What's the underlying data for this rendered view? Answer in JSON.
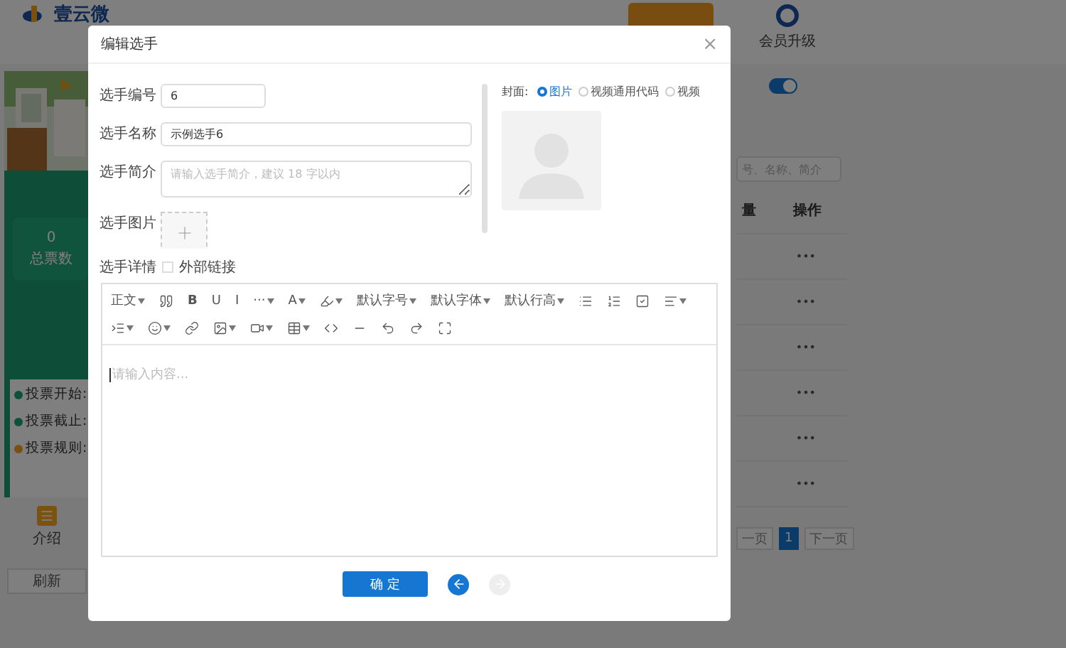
{
  "header": {
    "logo": "壹云微",
    "upgrade": "会员升级"
  },
  "preview": {
    "total_value": "0",
    "total_label": "总票数",
    "info": [
      {
        "label": "投票开始:",
        "color": "#0d513d"
      },
      {
        "label": "投票截止:",
        "color": "#0d513d"
      },
      {
        "label": "投票规则:",
        "color": "#785010"
      }
    ],
    "tab": "介绍",
    "refresh": "刷新"
  },
  "side": {
    "toggle_on": true,
    "search_placeholder": "号、名称、简介",
    "columns": [
      "量",
      "操作"
    ],
    "rows": [
      "•••",
      "•••",
      "•••",
      "•••",
      "•••",
      "•••"
    ],
    "pagination": [
      {
        "label": "一页",
        "selected": false
      },
      {
        "label": "1",
        "selected": true
      },
      {
        "label": "下一页",
        "selected": false
      }
    ]
  },
  "dialog": {
    "title": "编辑选手",
    "close": "×",
    "fields": [
      {
        "label": "选手编号",
        "kind": "short",
        "value": "6"
      },
      {
        "label": "选手名称",
        "kind": "long",
        "value": "示例选手6"
      },
      {
        "label": "选手简介",
        "kind": "area",
        "placeholder": "请输入选手简介，建议 18 字以内"
      },
      {
        "label": "选手图片",
        "kind": "upload"
      }
    ],
    "detail": {
      "label": "选手详情",
      "checkbox": "外部链接",
      "checked": false
    },
    "cover": {
      "label": "封面:",
      "options": [
        {
          "label": "图片",
          "selected": true
        },
        {
          "label": "视频通用代码",
          "selected": false
        },
        {
          "label": "视频",
          "selected": false
        }
      ]
    },
    "toolbar": [
      [
        {
          "label": "正文",
          "dropdown": true
        },
        {
          "dropdown": false
        },
        {
          "label": "B",
          "dropdown": false
        },
        {
          "label": "U",
          "dropdown": false
        },
        {
          "label": "I",
          "dropdown": false
        },
        {
          "label": "···",
          "dropdown": true
        },
        {
          "label": "A",
          "dropdown": true
        },
        {
          "dropdown": true
        },
        {
          "label": "默认字号",
          "dropdown": true
        },
        {
          "label": "默认字体",
          "dropdown": true
        },
        {
          "label": "默认行高",
          "dropdown": true
        },
        {
          "dropdown": false
        },
        {
          "dropdown": false
        },
        {
          "dropdown": false
        },
        {
          "dropdown": true
        }
      ],
      [
        {
          "dropdown": true
        },
        {
          "dropdown": true
        },
        {
          "dropdown": false
        },
        {
          "dropdown": true
        },
        {
          "dropdown": true
        },
        {
          "dropdown": true
        },
        {
          "dropdown": false
        },
        {
          "dropdown": false
        },
        {
          "dropdown": false
        },
        {
          "dropdown": false
        },
        {
          "dropdown": false
        }
      ]
    ],
    "editor_placeholder": "请输入内容...",
    "confirm": "确 定",
    "prev_enabled": true,
    "next_enabled": false
  }
}
